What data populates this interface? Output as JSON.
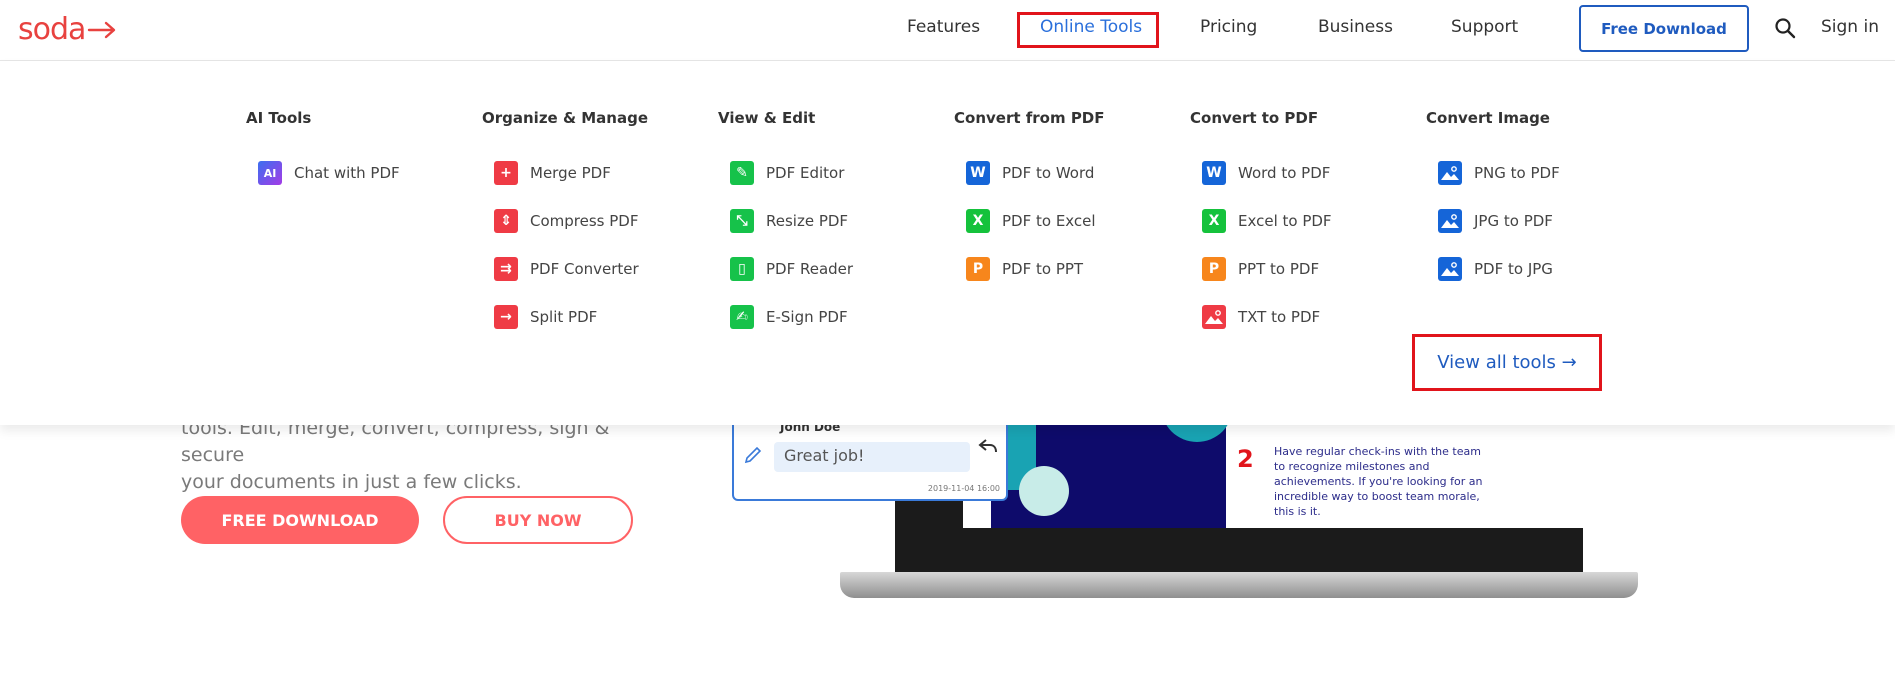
{
  "header": {
    "logo_text": "soda",
    "nav": [
      "Features",
      "Online Tools",
      "Pricing",
      "Business",
      "Support"
    ],
    "free_download": "Free Download",
    "sign_in": "Sign in"
  },
  "hero": {
    "text_line1": "tools. Edit, merge, convert, compress, sign & secure",
    "text_line2": "your documents in just a few clicks.",
    "primary_button": "FREE DOWNLOAD",
    "secondary_button": "BUY NOW"
  },
  "mockup": {
    "comment_name": "John Doe",
    "comment_text": "Great job!",
    "comment_time": "2019-11-04 16:00",
    "tip_number": "2",
    "tip_text": "Have regular check-ins with the team to recognize milestones and achievements. If you're looking for an incredible way to boost team morale, this is it."
  },
  "dropdown": {
    "columns": [
      {
        "title": "AI Tools",
        "items": [
          {
            "label": "Chat with PDF",
            "icon": "ai-icon"
          }
        ]
      },
      {
        "title": "Organize & Manage",
        "items": [
          {
            "label": "Merge PDF",
            "icon": "merge-icon"
          },
          {
            "label": "Compress PDF",
            "icon": "compress-icon"
          },
          {
            "label": "PDF Converter",
            "icon": "converter-icon"
          },
          {
            "label": "Split PDF",
            "icon": "split-icon"
          }
        ]
      },
      {
        "title": "View & Edit",
        "items": [
          {
            "label": "PDF Editor",
            "icon": "edit-icon"
          },
          {
            "label": "Resize PDF",
            "icon": "resize-icon"
          },
          {
            "label": "PDF Reader",
            "icon": "book-icon"
          },
          {
            "label": "E-Sign PDF",
            "icon": "sign-icon"
          }
        ]
      },
      {
        "title": "Convert from PDF",
        "items": [
          {
            "label": "PDF to Word",
            "icon": "word-icon"
          },
          {
            "label": "PDF to Excel",
            "icon": "excel-icon"
          },
          {
            "label": "PDF to PPT",
            "icon": "ppt-icon"
          }
        ]
      },
      {
        "title": "Convert to PDF",
        "items": [
          {
            "label": "Word to PDF",
            "icon": "word-icon"
          },
          {
            "label": "Excel to PDF",
            "icon": "excel-icon"
          },
          {
            "label": "PPT to PDF",
            "icon": "ppt-icon"
          },
          {
            "label": "TXT to PDF",
            "icon": "txt-icon"
          }
        ]
      },
      {
        "title": "Convert Image",
        "items": [
          {
            "label": "PNG to PDF",
            "icon": "image-icon"
          },
          {
            "label": "JPG to PDF",
            "icon": "image-icon"
          },
          {
            "label": "PDF to JPG",
            "icon": "image-icon"
          }
        ]
      }
    ],
    "view_all": "View all tools →"
  },
  "colors": {
    "accent_red": "#e8423f",
    "accent_blue": "#1f5bbf",
    "word_blue": "#1565d8",
    "excel_green": "#15c23c",
    "ppt_orange": "#f7861c",
    "organize_red": "#ef3b45",
    "edit_green": "#16c24a"
  }
}
